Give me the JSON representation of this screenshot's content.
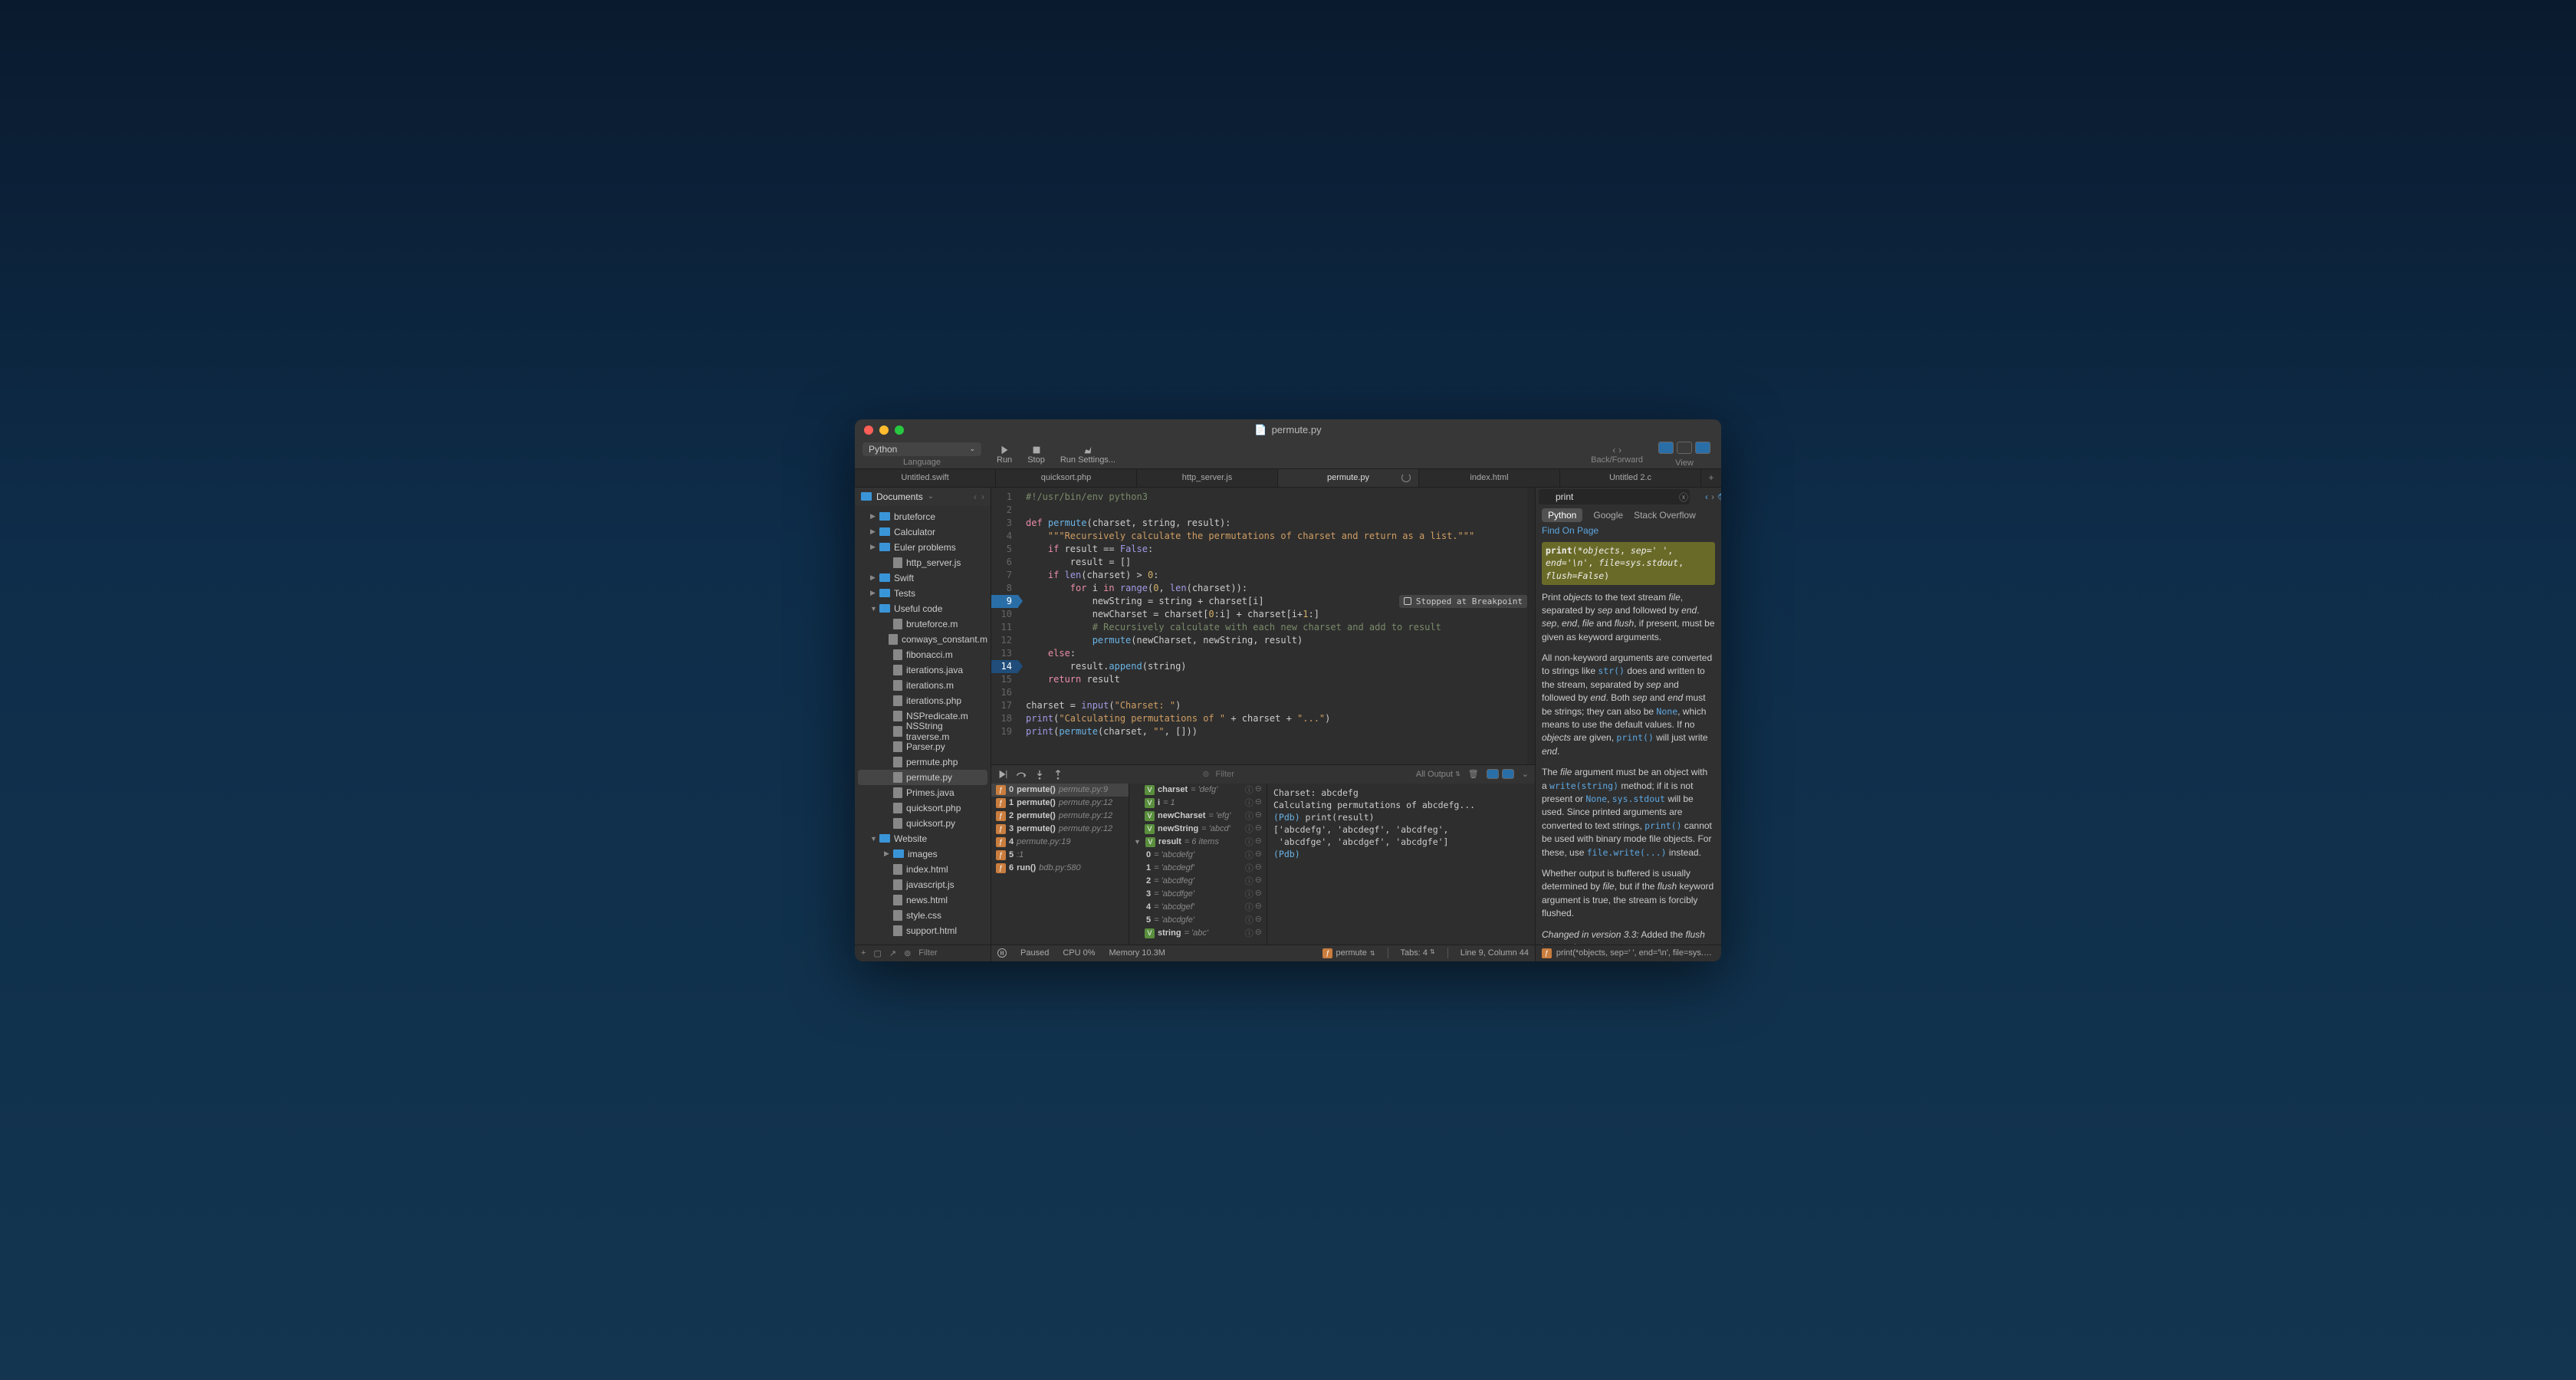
{
  "window": {
    "title": "permute.py"
  },
  "toolbar": {
    "language": "Python",
    "language_label": "Language",
    "run": "Run",
    "stop": "Stop",
    "run_settings": "Run Settings...",
    "back_forward": "Back/Forward",
    "view": "View"
  },
  "tabs": [
    "Untitled.swift",
    "quicksort.php",
    "http_server.js",
    "permute.py",
    "index.html",
    "Untitled 2.c"
  ],
  "active_tab": "permute.py",
  "sidebar": {
    "root": "Documents",
    "rows": [
      {
        "d": 1,
        "t": "folder",
        "n": "bruteforce",
        "disc": "▶"
      },
      {
        "d": 1,
        "t": "folder",
        "n": "Calculator",
        "disc": "▶"
      },
      {
        "d": 1,
        "t": "folder",
        "n": "Euler problems",
        "disc": "▶"
      },
      {
        "d": 2,
        "t": "file",
        "n": "http_server.js"
      },
      {
        "d": 1,
        "t": "folder",
        "n": "Swift",
        "disc": "▶"
      },
      {
        "d": 1,
        "t": "folder",
        "n": "Tests",
        "disc": "▶"
      },
      {
        "d": 1,
        "t": "folder",
        "n": "Useful code",
        "disc": "▼"
      },
      {
        "d": 2,
        "t": "file",
        "n": "bruteforce.m"
      },
      {
        "d": 2,
        "t": "file",
        "n": "conways_constant.m"
      },
      {
        "d": 2,
        "t": "file",
        "n": "fibonacci.m"
      },
      {
        "d": 2,
        "t": "file",
        "n": "iterations.java"
      },
      {
        "d": 2,
        "t": "file",
        "n": "iterations.m"
      },
      {
        "d": 2,
        "t": "file",
        "n": "iterations.php"
      },
      {
        "d": 2,
        "t": "file",
        "n": "NSPredicate.m"
      },
      {
        "d": 2,
        "t": "file",
        "n": "NSString traverse.m"
      },
      {
        "d": 2,
        "t": "file",
        "n": "Parser.py"
      },
      {
        "d": 2,
        "t": "file",
        "n": "permute.php"
      },
      {
        "d": 2,
        "t": "file",
        "n": "permute.py",
        "sel": true
      },
      {
        "d": 2,
        "t": "file",
        "n": "Primes.java"
      },
      {
        "d": 2,
        "t": "file",
        "n": "quicksort.php"
      },
      {
        "d": 2,
        "t": "file",
        "n": "quicksort.py"
      },
      {
        "d": 1,
        "t": "folder",
        "n": "Website",
        "disc": "▼"
      },
      {
        "d": 2,
        "t": "folder",
        "n": "images",
        "disc": "▶"
      },
      {
        "d": 2,
        "t": "file",
        "n": "index.html"
      },
      {
        "d": 2,
        "t": "file",
        "n": "javascript.js"
      },
      {
        "d": 2,
        "t": "file",
        "n": "news.html"
      },
      {
        "d": 2,
        "t": "file",
        "n": "style.css"
      },
      {
        "d": 2,
        "t": "file",
        "n": "support.html"
      }
    ],
    "footer_filter": "Filter"
  },
  "editor": {
    "breakpoint_line": 9,
    "arrow_line": 14,
    "badge_text": "Stopped at Breakpoint",
    "lines": 19
  },
  "debug": {
    "filter_placeholder": "Filter",
    "output_label": "All Output",
    "stack": [
      {
        "idx": "0",
        "fn": "permute()",
        "loc": "permute.py:9",
        "sel": true
      },
      {
        "idx": "1",
        "fn": "permute()",
        "loc": "permute.py:12"
      },
      {
        "idx": "2",
        "fn": "permute()",
        "loc": "permute.py:12"
      },
      {
        "idx": "3",
        "fn": "permute()",
        "loc": "permute.py:12"
      },
      {
        "idx": "4",
        "fn": "",
        "loc": "permute.py:19"
      },
      {
        "idx": "5",
        "fn": "",
        "loc": "<string>:1"
      },
      {
        "idx": "6",
        "fn": "run()",
        "loc": "bdb.py:580"
      }
    ],
    "vars": [
      {
        "b": "V",
        "n": "charset",
        "v": "= 'defg'"
      },
      {
        "b": "V",
        "n": "i",
        "v": "= 1"
      },
      {
        "b": "V",
        "n": "newCharset",
        "v": "= 'efg'"
      },
      {
        "b": "V",
        "n": "newString",
        "v": "= 'abcd'"
      },
      {
        "b": "V",
        "n": "result",
        "v": "= 6 items",
        "exp": true
      },
      {
        "b": "",
        "n": "0",
        "v": "= 'abcdefg'",
        "d": 1
      },
      {
        "b": "",
        "n": "1",
        "v": "= 'abcdegf'",
        "d": 1
      },
      {
        "b": "",
        "n": "2",
        "v": "= 'abcdfeg'",
        "d": 1
      },
      {
        "b": "",
        "n": "3",
        "v": "= 'abcdfge'",
        "d": 1
      },
      {
        "b": "",
        "n": "4",
        "v": "= 'abcdgef'",
        "d": 1
      },
      {
        "b": "",
        "n": "5",
        "v": "= 'abcdgfe'",
        "d": 1
      },
      {
        "b": "V",
        "n": "string",
        "v": "= 'abc'"
      }
    ],
    "console_lines": [
      "Charset: abcdefg",
      "Calculating permutations of abcdefg...",
      "(Pdb) print(result)",
      "['abcdefg', 'abcdegf', 'abcdfeg',",
      " 'abcdfge', 'abcdgef', 'abcdgfe']",
      "(Pdb) "
    ]
  },
  "status": {
    "paused": "Paused",
    "cpu": "CPU 0%",
    "memory": "Memory 10.3M",
    "func": "permute",
    "tabs": "Tabs: 4",
    "pos": "Line 9, Column 44",
    "sig": "print(*objects, sep=' ', end='\\n', file=sys.st..."
  },
  "doc": {
    "search": "print",
    "providers": [
      "Python",
      "Google",
      "Stack Overflow"
    ],
    "find_link": "Find On Page",
    "signature": "print(*objects, sep=' ', end='\\n', file=sys.stdout, flush=False)"
  }
}
